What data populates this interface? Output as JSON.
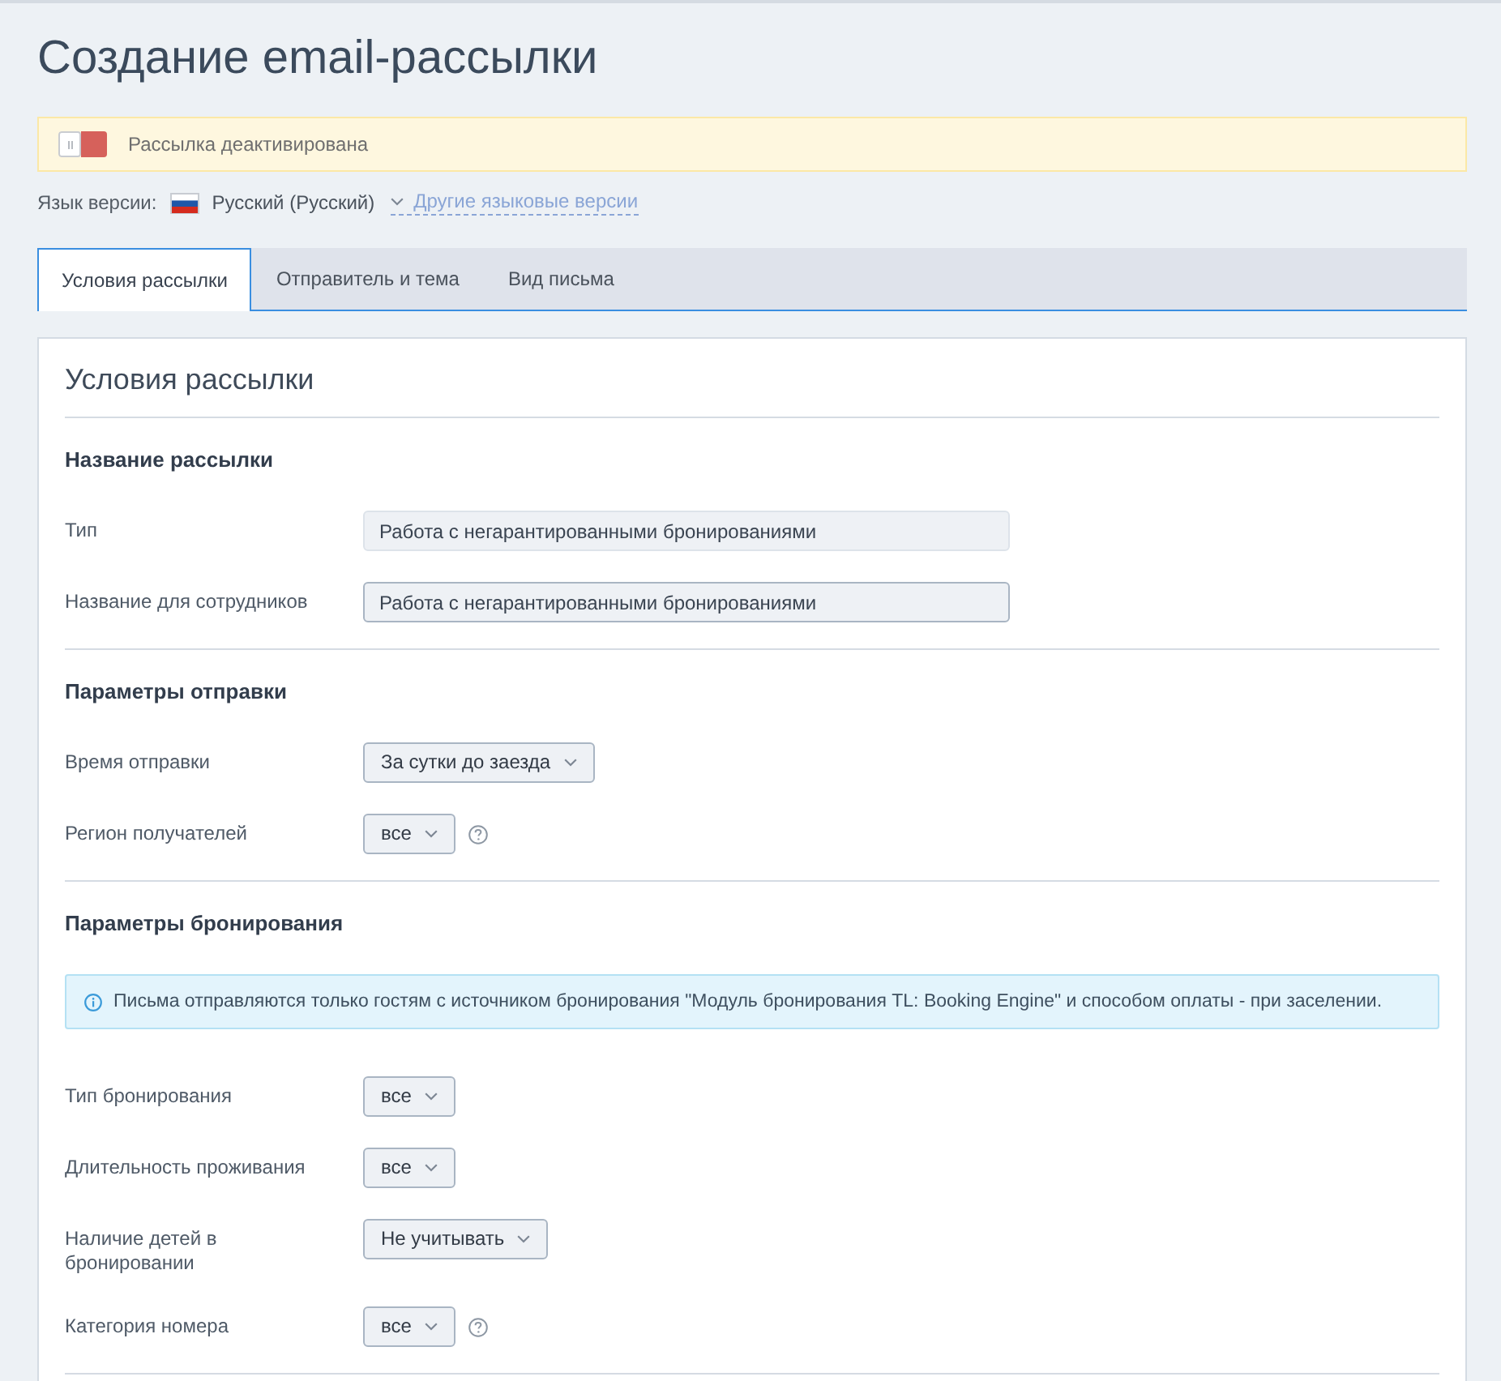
{
  "page": {
    "title": "Создание email-рассылки"
  },
  "status_banner": {
    "on": false,
    "text": "Рассылка деактивирована"
  },
  "language": {
    "label": "Язык версии:",
    "current": "Русский (Русский)",
    "other_link": "Другие языковые версии"
  },
  "tabs": [
    {
      "label": "Условия рассылки",
      "selected": true
    },
    {
      "label": "Отправитель и тема",
      "selected": false
    },
    {
      "label": "Вид письма",
      "selected": false
    }
  ],
  "panel": {
    "title": "Условия рассылки",
    "sections": [
      {
        "title": "Название рассылки",
        "rows": [
          {
            "kind": "text",
            "label": "Тип",
            "value": "Работа с негарантированными бронированиями",
            "disabled": true
          },
          {
            "kind": "text",
            "label": "Название для сотрудников",
            "value": "Работа с негарантированными бронированиями",
            "disabled": false
          }
        ]
      },
      {
        "title": "Параметры отправки",
        "rows": [
          {
            "kind": "select",
            "label": "Время отправки",
            "value": "За сутки до заезда"
          },
          {
            "kind": "select",
            "label": "Регион получателей",
            "value": "все",
            "help": true
          }
        ]
      },
      {
        "title": "Параметры бронирования",
        "notice": "Письма отправляются только гостям с источником бронирования \"Модуль бронирования TL: Booking Engine\" и способом оплаты - при заселении.",
        "rows": [
          {
            "kind": "select",
            "label": "Тип бронирования",
            "value": "все"
          },
          {
            "kind": "select",
            "label": "Длительность проживания",
            "value": "все"
          },
          {
            "kind": "select",
            "label": "Наличие детей в бронировании",
            "value": "Не учитывать"
          },
          {
            "kind": "select",
            "label": "Категория номера",
            "value": "все",
            "help": true
          }
        ]
      }
    ]
  }
}
